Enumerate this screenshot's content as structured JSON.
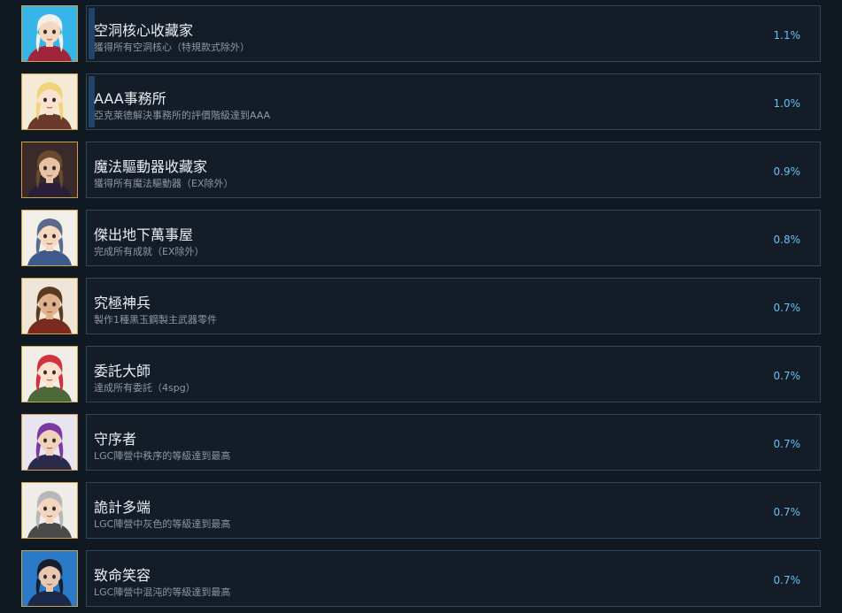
{
  "achievements": [
    {
      "title": "空洞核心收藏家",
      "desc": "獲得所有空洞核心（特規款式除外）",
      "percent": "1.1%",
      "progress": 0.011,
      "icon": "portrait-white-haired-man-icon",
      "palette": {
        "bg": "#35b5e8",
        "hair": "#f2efe8",
        "skin": "#f3d7c0",
        "cloth": "#a0243a"
      }
    },
    {
      "title": "AAA事務所",
      "desc": "亞克萊德解決事務所的評價階級達到AAA",
      "percent": "1.0%",
      "progress": 0.01,
      "icon": "portrait-blonde-girl-icon",
      "palette": {
        "bg": "#f4ead6",
        "hair": "#f2d27a",
        "skin": "#fbe3cf",
        "cloth": "#6b3a2a"
      }
    },
    {
      "title": "魔法驅動器收藏家",
      "desc": "獲得所有魔法驅動器（EX除外）",
      "percent": "0.9%",
      "progress": 0.009,
      "icon": "portrait-witch-hat-icon",
      "palette": {
        "bg": "#3a2a2a",
        "hair": "#6a4a2e",
        "skin": "#e7c3a5",
        "cloth": "#2a1f3a"
      }
    },
    {
      "title": "傑出地下萬事屋",
      "desc": "完成所有成就（EX除外）",
      "percent": "0.8%",
      "progress": 0.008,
      "icon": "portrait-blue-haired-boy-icon",
      "palette": {
        "bg": "#f2efe9",
        "hair": "#5a6a8a",
        "skin": "#f4d8c0",
        "cloth": "#3d5a8a"
      }
    },
    {
      "title": "究極神兵",
      "desc": "製作1種黑玉鋼製主武器零件",
      "percent": "0.7%",
      "progress": 0.007,
      "icon": "portrait-bearded-man-icon",
      "palette": {
        "bg": "#efe6d8",
        "hair": "#5a3a22",
        "skin": "#e0b08a",
        "cloth": "#7a2a1e"
      }
    },
    {
      "title": "委託大師",
      "desc": "達成所有委託（4spg）",
      "percent": "0.7%",
      "progress": 0.007,
      "icon": "portrait-red-haired-girl-icon",
      "palette": {
        "bg": "#f2ede6",
        "hair": "#d2323a",
        "skin": "#fbe0cc",
        "cloth": "#4a6a3a"
      }
    },
    {
      "title": "守序者",
      "desc": "LGC陣營中秩序的等級達到最高",
      "percent": "0.7%",
      "progress": 0.007,
      "icon": "portrait-purple-haired-man-icon",
      "palette": {
        "bg": "#e8e4f0",
        "hair": "#7a3aa0",
        "skin": "#f0d2bc",
        "cloth": "#2a2a4a"
      }
    },
    {
      "title": "詭計多端",
      "desc": "LGC陣營中灰色的等級達到最高",
      "percent": "0.7%",
      "progress": 0.007,
      "icon": "portrait-silver-haired-man-icon",
      "palette": {
        "bg": "#f0ece6",
        "hair": "#b8b8b8",
        "skin": "#f2d6c0",
        "cloth": "#4a4a4a"
      }
    },
    {
      "title": "致命笑容",
      "desc": "LGC陣營中混沌的等級達到最高",
      "percent": "0.7%",
      "progress": 0.007,
      "icon": "portrait-dark-haired-man-icon",
      "palette": {
        "bg": "#2a7ac8",
        "hair": "#1a1e2a",
        "skin": "#e8c8b0",
        "cloth": "#1a2a4a"
      }
    }
  ]
}
